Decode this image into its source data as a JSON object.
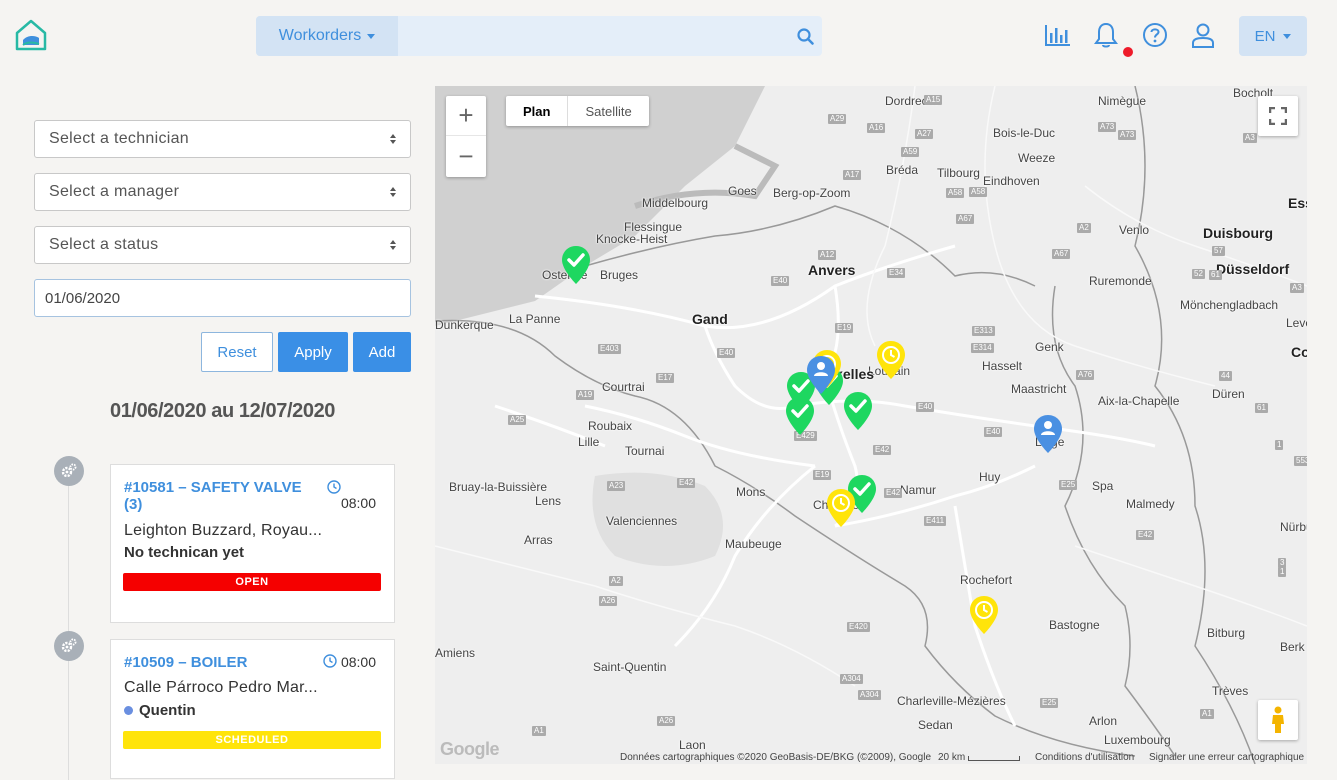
{
  "header": {
    "search_dropdown": "Workorders",
    "search_placeholder": "",
    "language": "EN",
    "icons": [
      "logo-house-icon",
      "stats-icon",
      "bell-icon",
      "help-icon",
      "user-icon",
      "search-icon"
    ]
  },
  "filters": {
    "technician_placeholder": "Select a technician",
    "manager_placeholder": "Select a manager",
    "status_placeholder": "Select a status",
    "date_value": "01/06/2020",
    "reset_label": "Reset",
    "apply_label": "Apply",
    "add_label": "Add"
  },
  "range_title": "01/06/2020 au 12/07/2020",
  "workorders": [
    {
      "title": "#10581 – SAFETY VALVE (3)",
      "time": "08:00",
      "address": "Leighton Buzzard, Royau...",
      "technician": "No technican yet",
      "status": "OPEN",
      "status_color": "#f50000"
    },
    {
      "title": "#10509 – BOILER",
      "time": "08:00",
      "address": "Calle Párroco Pedro Mar...",
      "technician": "Quentin",
      "status": "SCHEDULED",
      "status_color": "#ffe40a"
    }
  ],
  "map": {
    "type_plan": "Plan",
    "type_satellite": "Satellite",
    "google": "Google",
    "attribution": "Données cartographiques ©2020 GeoBasis-DE/BKG (©2009), Google",
    "scale": "20 km",
    "terms": "Conditions d'utilisation",
    "report": "Signaler une erreur cartographique",
    "cities": [
      {
        "name": "Dordrecht",
        "cls": "city"
      },
      {
        "name": "Nimègue",
        "cls": "city"
      },
      {
        "name": "Bocholt",
        "cls": "city"
      },
      {
        "name": "Bois-le-Duc",
        "cls": "city"
      },
      {
        "name": "Middelbourg",
        "cls": "city"
      },
      {
        "name": "Goes",
        "cls": "city"
      },
      {
        "name": "Berg-op-Zoom",
        "cls": "city"
      },
      {
        "name": "Bréda",
        "cls": "city"
      },
      {
        "name": "Tilbourg",
        "cls": "city"
      },
      {
        "name": "Weeze",
        "cls": "city"
      },
      {
        "name": "Eindhoven",
        "cls": "city"
      },
      {
        "name": "Ess",
        "cls": "city bold"
      },
      {
        "name": "Flessingue",
        "cls": "city"
      },
      {
        "name": "Knocke-Heist",
        "cls": "city"
      },
      {
        "name": "Duisbourg",
        "cls": "city bold"
      },
      {
        "name": "Venlo",
        "cls": "city"
      },
      {
        "name": "Ostende",
        "cls": "city"
      },
      {
        "name": "Bruges",
        "cls": "city"
      },
      {
        "name": "Anvers",
        "cls": "city bold"
      },
      {
        "name": "Düsseldorf",
        "cls": "city bold"
      },
      {
        "name": "Ruremonde",
        "cls": "city"
      },
      {
        "name": "Mönchengladbach",
        "cls": "city"
      },
      {
        "name": "Dunkerque",
        "cls": "city"
      },
      {
        "name": "La Panne",
        "cls": "city"
      },
      {
        "name": "Gand",
        "cls": "city bold"
      },
      {
        "name": "Lever",
        "cls": "city"
      },
      {
        "name": "Genk",
        "cls": "city"
      },
      {
        "name": "Colog",
        "cls": "city bold"
      },
      {
        "name": "Hasselt",
        "cls": "city"
      },
      {
        "name": "Louvain",
        "cls": "city"
      },
      {
        "name": "Bruxelles",
        "cls": "city bold"
      },
      {
        "name": "Maastricht",
        "cls": "city"
      },
      {
        "name": "Courtrai",
        "cls": "city"
      },
      {
        "name": "Aix-la-Chapelle",
        "cls": "city"
      },
      {
        "name": "Düren",
        "cls": "city"
      },
      {
        "name": "Roubaix",
        "cls": "city"
      },
      {
        "name": "Lille",
        "cls": "city"
      },
      {
        "name": "Tournai",
        "cls": "city"
      },
      {
        "name": "Liège",
        "cls": "city"
      },
      {
        "name": "Huy",
        "cls": "city"
      },
      {
        "name": "Bruay-la-Buissière",
        "cls": "city"
      },
      {
        "name": "Mons",
        "cls": "city"
      },
      {
        "name": "Namur",
        "cls": "city"
      },
      {
        "name": "Spa",
        "cls": "city"
      },
      {
        "name": "Lens",
        "cls": "city"
      },
      {
        "name": "Charleroi",
        "cls": "city"
      },
      {
        "name": "Malmedy",
        "cls": "city"
      },
      {
        "name": "Valenciennes",
        "cls": "city"
      },
      {
        "name": "Nürbu",
        "cls": "city"
      },
      {
        "name": "Arras",
        "cls": "city"
      },
      {
        "name": "Maubeuge",
        "cls": "city"
      },
      {
        "name": "Rochefort",
        "cls": "city"
      },
      {
        "name": "Bastogne",
        "cls": "city"
      },
      {
        "name": "Bitburg",
        "cls": "city"
      },
      {
        "name": "Amiens",
        "cls": "city"
      },
      {
        "name": "Saint-Quentin",
        "cls": "city"
      },
      {
        "name": "Berk",
        "cls": "city"
      },
      {
        "name": "Charleville-Mézières",
        "cls": "city"
      },
      {
        "name": "Trèves",
        "cls": "city"
      },
      {
        "name": "Sedan",
        "cls": "city"
      },
      {
        "name": "Arlon",
        "cls": "city"
      },
      {
        "name": "Laon",
        "cls": "city"
      },
      {
        "name": "Luxembourg",
        "cls": "city"
      }
    ],
    "roads": [
      "A15",
      "A73",
      "A29",
      "A16",
      "A27",
      "A59",
      "A17",
      "A58",
      "A58",
      "A67",
      "A2",
      "A67",
      "A12",
      "E34",
      "E40",
      "E19",
      "E313",
      "E314",
      "A76",
      "E40",
      "E403",
      "E40",
      "E17",
      "A19",
      "E42",
      "E25",
      "A25",
      "E19",
      "E42",
      "A23",
      "E429",
      "E42",
      "E411",
      "E40",
      "E42",
      "A2",
      "A26",
      "E420",
      "A304",
      "A304",
      "A26",
      "A1",
      "E25",
      "A1",
      "A73",
      "A3",
      "A3",
      "57",
      "52",
      "61",
      "44",
      "3",
      "1",
      "1",
      "61",
      "553"
    ],
    "markers": [
      {
        "type": "done",
        "color": "#1ed760"
      },
      {
        "type": "done",
        "color": "#1ed760"
      },
      {
        "type": "done",
        "color": "#1ed760"
      },
      {
        "type": "done",
        "color": "#1ed760"
      },
      {
        "type": "done",
        "color": "#1ed760"
      },
      {
        "type": "done",
        "color": "#1ed760"
      },
      {
        "type": "pending",
        "color": "#ffe40a"
      },
      {
        "type": "pending",
        "color": "#ffe40a"
      },
      {
        "type": "pending",
        "color": "#ffe40a"
      },
      {
        "type": "pending",
        "color": "#ffe40a"
      },
      {
        "type": "user",
        "color": "#4a90e2"
      },
      {
        "type": "user",
        "color": "#4a90e2"
      }
    ]
  }
}
